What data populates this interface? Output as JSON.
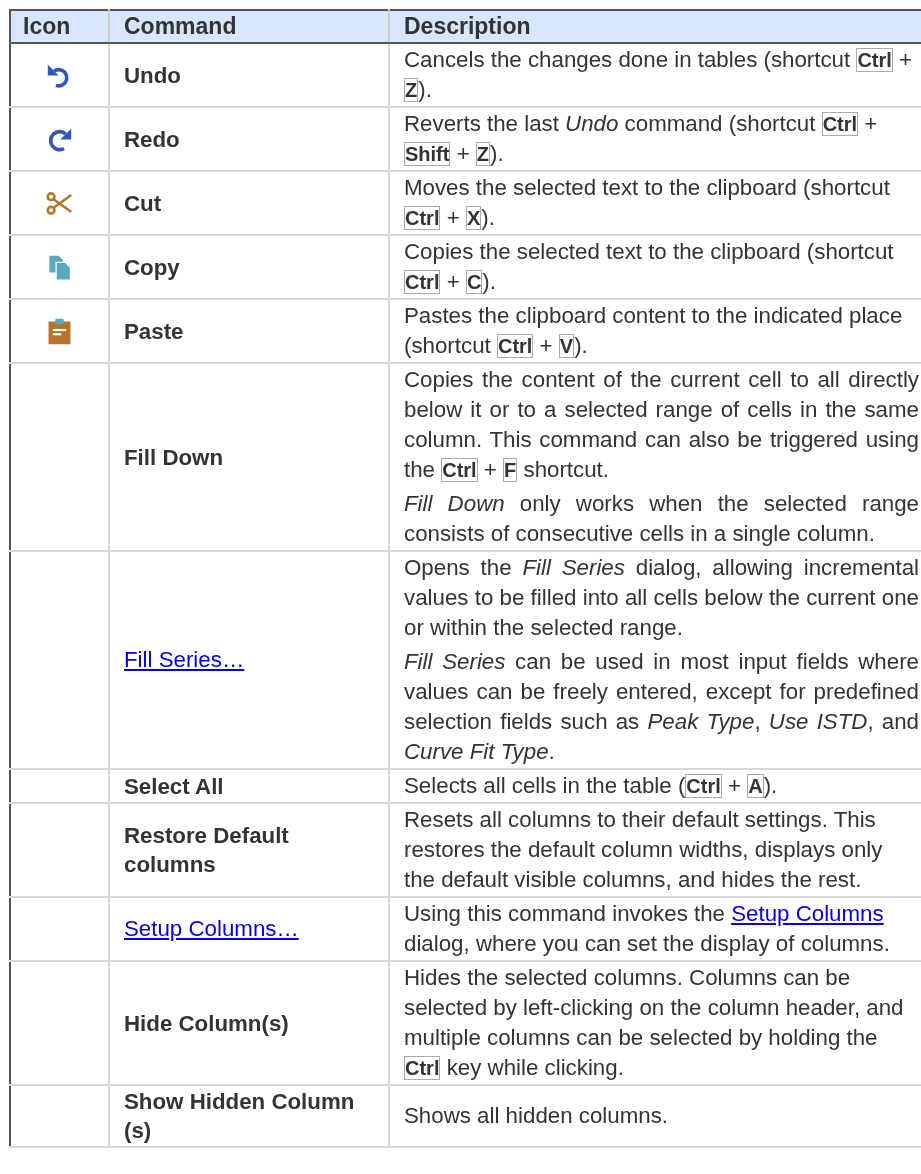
{
  "table": {
    "columns": [
      "Icon",
      "Command",
      "Description"
    ],
    "rows": [
      {
        "kind": "undo",
        "command": {
          "kind": "text",
          "text": "Undo"
        },
        "description": [
          [
            {
              "kind": "text",
              "text": "Cancels the changes done in tables (shortcut "
            },
            {
              "kind": "key",
              "text": "Ctrl"
            },
            {
              "kind": "text",
              "text": " + "
            },
            {
              "kind": "key",
              "text": "Z"
            },
            {
              "kind": "text",
              "text": ")."
            }
          ]
        ]
      },
      {
        "kind": "redo",
        "command": {
          "kind": "text",
          "text": "Redo"
        },
        "description": [
          [
            {
              "kind": "text",
              "text": "Reverts the last *Undo* command (shortcut "
            },
            {
              "kind": "key",
              "text": "Ctrl"
            },
            {
              "kind": "text",
              "text": " + "
            },
            {
              "kind": "key",
              "text": "Shift"
            },
            {
              "kind": "text",
              "text": " + "
            },
            {
              "kind": "key",
              "text": "Z"
            },
            {
              "kind": "text",
              "text": ")."
            }
          ]
        ]
      },
      {
        "kind": "cut",
        "command": {
          "kind": "text",
          "text": "Cut"
        },
        "description": [
          [
            {
              "kind": "text",
              "text": "Moves the selected text to the clipboard (shortcut "
            },
            {
              "kind": "key",
              "text": "Ctrl"
            },
            {
              "kind": "text",
              "text": " + "
            },
            {
              "kind": "key",
              "text": "X"
            },
            {
              "kind": "text",
              "text": ")."
            }
          ]
        ]
      },
      {
        "kind": "copy",
        "command": {
          "kind": "text",
          "text": "Copy"
        },
        "description": [
          [
            {
              "kind": "text",
              "text": "Copies the selected text to the clipboard (shortcut "
            },
            {
              "kind": "key",
              "text": "Ctrl"
            },
            {
              "kind": "text",
              "text": " + "
            },
            {
              "kind": "key",
              "text": "C"
            },
            {
              "kind": "text",
              "text": ")."
            }
          ]
        ]
      },
      {
        "kind": "paste",
        "command": {
          "kind": "text",
          "text": "Paste"
        },
        "description": [
          [
            {
              "kind": "text",
              "text": "Pastes the clipboard content to the indicated place (shortcut "
            },
            {
              "kind": "key",
              "text": "Ctrl"
            },
            {
              "kind": "text",
              "text": " + "
            },
            {
              "kind": "key",
              "text": "V"
            },
            {
              "kind": "text",
              "text": ")."
            }
          ]
        ]
      },
      {
        "kind": "plain",
        "command": {
          "kind": "text",
          "text": "Fill Down"
        },
        "justified": true,
        "description": [
          [
            {
              "kind": "text",
              "text": "Copies the content of the current cell to all directly below it or to a selected range of cells in the same column. This command can also be triggered using the "
            },
            {
              "kind": "key",
              "text": "Ctrl"
            },
            {
              "kind": "text",
              "text": " + "
            },
            {
              "kind": "key",
              "text": "F"
            },
            {
              "kind": "text",
              "text": " shortcut."
            }
          ],
          [
            {
              "kind": "text",
              "text": "*Fill Down* only works when the selected range consists of consecutive cells in a single column."
            }
          ]
        ]
      },
      {
        "kind": "plain",
        "command": {
          "kind": "link",
          "text": "Fill Series…"
        },
        "justified": true,
        "description": [
          [
            {
              "kind": "text",
              "text": "Opens the *Fill Series* dialog, allowing incremental values to be filled into all cells below the current one or within the selected range."
            }
          ],
          [
            {
              "kind": "text",
              "text": "*Fill Series* can be used in most input fields where values can be freely entered, except for predefined selection fields such as *Peak Type*, *Use ISTD*, and *Curve Fit Type*."
            }
          ]
        ]
      },
      {
        "kind": "plain",
        "command": {
          "kind": "text",
          "text": "Select All"
        },
        "description": [
          [
            {
              "kind": "text",
              "text": "Selects all cells in the table ("
            },
            {
              "kind": "key",
              "text": "Ctrl"
            },
            {
              "kind": "text",
              "text": " + "
            },
            {
              "kind": "key",
              "text": "A"
            },
            {
              "kind": "text",
              "text": ")."
            }
          ]
        ]
      },
      {
        "kind": "plain",
        "command": {
          "kind": "text",
          "text": "Restore Default columns"
        },
        "description": [
          [
            {
              "kind": "text",
              "text": "Resets all columns to their default settings. This restores the default column widths, displays only the default visible columns, and hides the rest."
            }
          ]
        ]
      },
      {
        "kind": "plain",
        "command": {
          "kind": "link",
          "text": "Setup Columns…"
        },
        "description": [
          [
            {
              "kind": "text",
              "text": "Using this command invokes the "
            },
            {
              "kind": "link",
              "text": "Setup Columns"
            },
            {
              "kind": "text",
              "text": " dialog, where you can set the display of columns."
            }
          ]
        ]
      },
      {
        "kind": "plain",
        "command": {
          "kind": "text",
          "text": "Hide Column(s)"
        },
        "description": [
          [
            {
              "kind": "text",
              "text": "Hides the selected columns. Columns can be selected by left-clicking on the column header, and multiple columns can be selected by holding the "
            },
            {
              "kind": "key",
              "text": "Ctrl"
            },
            {
              "kind": "text",
              "text": " key while clicking."
            }
          ]
        ]
      },
      {
        "kind": "plain",
        "command": {
          "kind": "text",
          "text": "Show Hidden Column (s)"
        },
        "description": [
          [
            {
              "kind": "text",
              "text": "Shows all hidden columns."
            }
          ]
        ]
      }
    ]
  }
}
